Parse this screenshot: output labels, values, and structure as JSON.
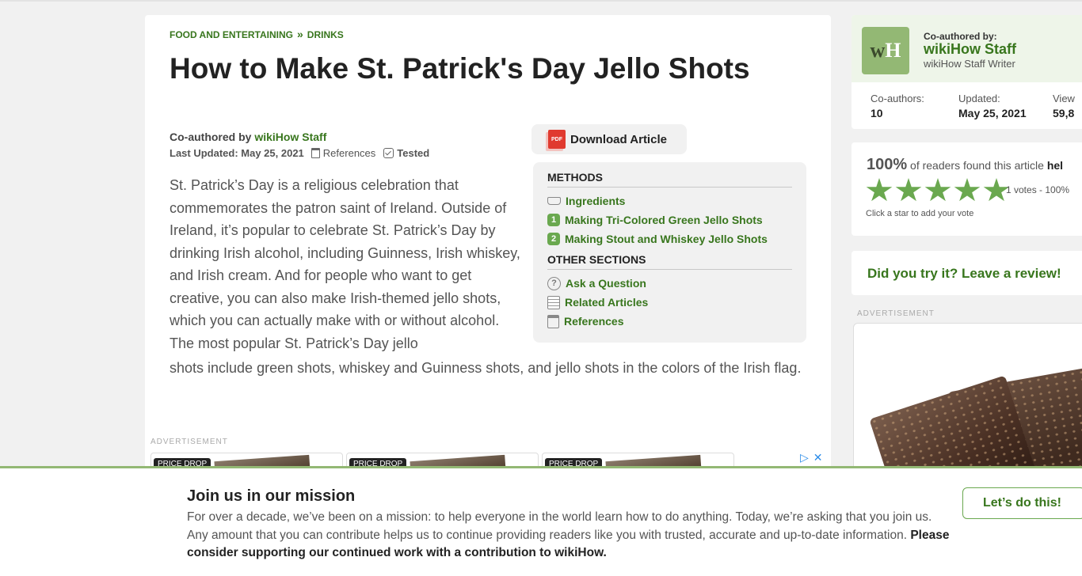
{
  "breadcrumb": {
    "category": "FOOD AND ENTERTAINING",
    "separator": "»",
    "subcategory": "DRINKS"
  },
  "article": {
    "title": "How to Make St. Patrick's Day Jello Shots",
    "byline_prefix": "Co-authored by ",
    "author": "wikiHow Staff",
    "last_updated": "Last Updated: May 25, 2021",
    "references_label": "References",
    "tested_label": "Tested",
    "intro_part1": "St. Patrick’s Day is a religious celebration that commemorates the patron saint of Ireland. Outside of Ireland, it’s popular to celebrate St. Patrick’s Day by drinking Irish alcohol, including Guinness, Irish whiskey, and Irish cream. And for people who want to get creative, you can also make Irish-themed jello shots, which you can actually make with or without alcohol. The most popular St. Patrick’s Day jello",
    "intro_part2": "shots include green shots, whiskey and Guinness shots, and jello shots in the colors of the Irish flag."
  },
  "download": {
    "label": "Download Article",
    "icon_text": "PDF"
  },
  "toc": {
    "methods_heading": "METHODS",
    "methods": [
      {
        "label": "Ingredients",
        "icon": "ingredients-icon"
      },
      {
        "label": "Making Tri-Colored Green Jello Shots",
        "num": "1"
      },
      {
        "label": "Making Stout and Whiskey Jello Shots",
        "num": "2"
      }
    ],
    "other_heading": "OTHER SECTIONS",
    "other": [
      {
        "label": "Ask a Question",
        "icon": "question-icon"
      },
      {
        "label": "Related Articles",
        "icon": "list-icon"
      },
      {
        "label": "References",
        "icon": "references-icon"
      }
    ]
  },
  "ads": {
    "label": "ADVERTISEMENT",
    "cards": [
      {
        "tag": "PRICE DROP"
      },
      {
        "tag": "PRICE DROP"
      },
      {
        "tag": "PRICE DROP"
      }
    ],
    "adchoices": "▷",
    "close": "✕"
  },
  "sidebar": {
    "coauthored_label": "Co-authored by:",
    "author_name": "wikiHow Staff",
    "author_role": "wikiHow Staff Writer",
    "logo_w": "w",
    "logo_h": "H",
    "stats": [
      {
        "label": "Co-authors:",
        "value": "10"
      },
      {
        "label": "Updated:",
        "value": "May 25, 2021"
      },
      {
        "label": "View",
        "value": "59,8"
      }
    ],
    "rating": {
      "percent": "100%",
      "text": " of readers found this article ",
      "text_bold": "hel",
      "votes": "1 votes - 100%",
      "hint": "Click a star to add your vote",
      "stars": 5
    },
    "review_cta": "Did you try it? Leave a review!",
    "ad_label": "ADVERTISEMENT"
  },
  "banner": {
    "title": "Join us in our mission",
    "text": "For over a decade, we’ve been on a mission: to help everyone in the world learn how to do anything. Today, we’re asking that you join us. Any amount that you can contribute helps us to continue providing readers like you with trusted, accurate and up-to-date information. ",
    "text_bold": "Please consider supporting our continued work with a contribution to wikiHow.",
    "button": "Let’s do this!"
  },
  "colors": {
    "brand_green": "#38761d",
    "accent_green": "#6aa84f",
    "light_green": "#93b874"
  }
}
